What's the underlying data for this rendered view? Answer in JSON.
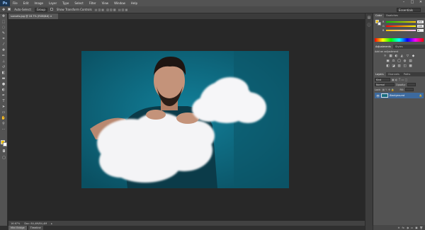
{
  "app": {
    "logo": "Ps",
    "menu": [
      "File",
      "Edit",
      "Image",
      "Layer",
      "Type",
      "Select",
      "Filter",
      "View",
      "Window",
      "Help"
    ],
    "window_controls": [
      "–",
      "□",
      "✕"
    ]
  },
  "options_bar": {
    "auto_select_label": "Auto-Select:",
    "auto_select_value": "Group",
    "show_transform_label": "Show Transform Controls",
    "workspace": "Essentials"
  },
  "document": {
    "tab_title": "sunsets.jpg @ 16.7% (RGB/8#) ×",
    "zoom": "16.67%",
    "doc_size": "Doc: 84,4M/84,4M"
  },
  "bottom_tabs": [
    "Mini Bridge",
    "Timeline"
  ],
  "color_panel": {
    "tabs": [
      "Color",
      "Swatches"
    ],
    "sliders": [
      {
        "label": "R",
        "value": "255"
      },
      {
        "label": "G",
        "value": "198"
      },
      {
        "label": "B",
        "value": "0"
      }
    ]
  },
  "adjustments_panel": {
    "tabs": [
      "Adjustments",
      "Styles"
    ],
    "heading": "Add an adjustment",
    "icons_row1": [
      "☼",
      "▦",
      "◐",
      "◭",
      "▽",
      "◆"
    ],
    "icons_row2": [
      "▣",
      "⚖",
      "◯",
      "◍",
      "▤"
    ],
    "icons_row3": [
      "◧",
      "◪",
      "▥",
      "◫",
      "▩"
    ]
  },
  "layers_panel": {
    "tabs": [
      "Layers",
      "Channels",
      "Paths"
    ],
    "kind_filter": "Kind",
    "blend_mode": "Normal",
    "opacity_label": "Opacity:",
    "lock_label": "Lock:",
    "fill_label": "Fill:",
    "layer_name": "Background",
    "footer_icons": [
      "⊖",
      "fx",
      "◑",
      "▭",
      "▣",
      "🗑"
    ]
  },
  "colors": {
    "accent_fg": "#f0c200",
    "photo_bg": "#0f6b80"
  }
}
